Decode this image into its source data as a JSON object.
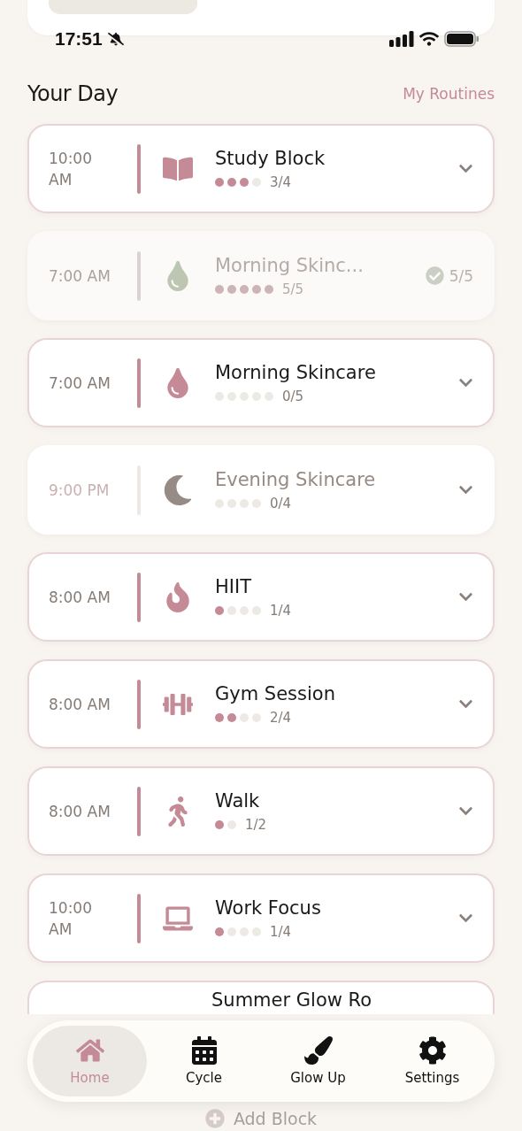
{
  "status_bar": {
    "time": "17:51"
  },
  "header": {
    "title": "Your Day",
    "link": "My Routines"
  },
  "blocks": [
    {
      "kind": "active",
      "time": "10:00 AM",
      "title": "Study Block",
      "steps": [
        {
          "done": true
        },
        {
          "done": true
        },
        {
          "done": true
        },
        {
          "done": false
        }
      ],
      "count": "3/4"
    },
    {
      "kind": "done",
      "time": "7:00 AM",
      "title": "Morning Skinc...",
      "steps": [
        {
          "done": true
        },
        {
          "done": true
        },
        {
          "done": true
        },
        {
          "done": true
        },
        {
          "done": true
        }
      ],
      "count": "5/5",
      "result": "5/5"
    },
    {
      "kind": "active",
      "time": "7:00 AM",
      "title": "Morning Skincare",
      "steps": [
        {
          "done": false
        },
        {
          "done": false
        },
        {
          "done": false
        },
        {
          "done": false
        },
        {
          "done": false
        }
      ],
      "count": "0/5"
    },
    {
      "kind": "muted",
      "time": "9:00 PM",
      "title": "Evening Skincare",
      "steps": [
        {
          "done": false
        },
        {
          "done": false
        },
        {
          "done": false
        },
        {
          "done": false
        }
      ],
      "count": "0/4"
    },
    {
      "kind": "active",
      "time": "8:00 AM",
      "title": "HIIT",
      "steps": [
        {
          "done": true
        },
        {
          "done": false
        },
        {
          "done": false
        },
        {
          "done": false
        }
      ],
      "count": "1/4"
    },
    {
      "kind": "active",
      "time": "8:00 AM",
      "title": "Gym Session",
      "steps": [
        {
          "done": true
        },
        {
          "done": true
        },
        {
          "done": false
        },
        {
          "done": false
        }
      ],
      "count": "2/4"
    },
    {
      "kind": "active",
      "time": "8:00 AM",
      "title": "Walk",
      "steps": [
        {
          "done": true
        },
        {
          "done": false
        }
      ],
      "count": "1/2"
    },
    {
      "kind": "active",
      "time": "10:00 AM",
      "title": "Work Focus",
      "steps": [
        {
          "done": true
        },
        {
          "done": false
        },
        {
          "done": false
        },
        {
          "done": false
        }
      ],
      "count": "1/4"
    },
    {
      "kind": "active",
      "title": "Summer Glow Ro"
    }
  ],
  "add_button": {
    "label": "Add Block"
  },
  "tabs": [
    {
      "label": "Home",
      "selected": true
    },
    {
      "label": "Cycle",
      "selected": false
    },
    {
      "label": "Glow Up",
      "selected": false
    },
    {
      "label": "Settings",
      "selected": false
    }
  ]
}
